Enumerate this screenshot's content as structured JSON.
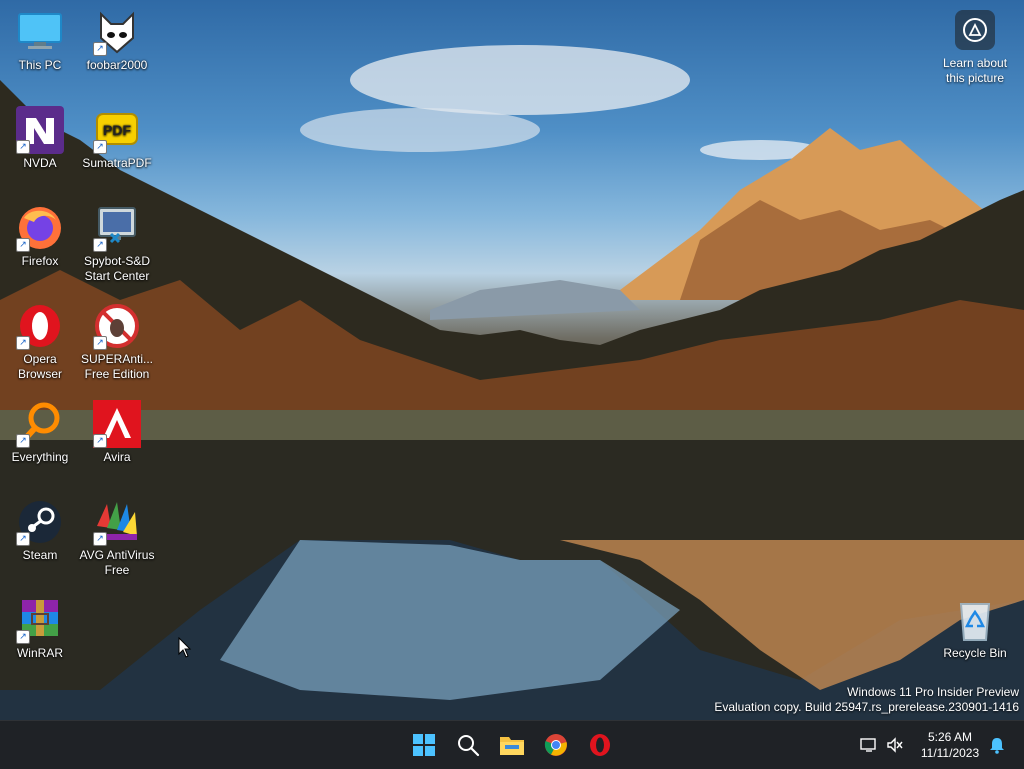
{
  "desktop": {
    "icons": [
      {
        "id": "this-pc",
        "label": "This PC"
      },
      {
        "id": "foobar2000",
        "label": "foobar2000"
      },
      {
        "id": "nvda",
        "label": "NVDA"
      },
      {
        "id": "sumatrapdf",
        "label": "SumatraPDF"
      },
      {
        "id": "firefox",
        "label": "Firefox"
      },
      {
        "id": "spybot",
        "label": "Spybot-S&D Start Center"
      },
      {
        "id": "opera",
        "label": "Opera Browser"
      },
      {
        "id": "superantispyware",
        "label": "SUPERAnti... Free Edition"
      },
      {
        "id": "everything",
        "label": "Everything"
      },
      {
        "id": "avira",
        "label": "Avira"
      },
      {
        "id": "steam",
        "label": "Steam"
      },
      {
        "id": "avg",
        "label": "AVG AntiVirus Free"
      },
      {
        "id": "winrar",
        "label": "WinRAR"
      },
      {
        "id": "recycle-bin",
        "label": "Recycle Bin"
      }
    ],
    "learn_about": "Learn about this picture",
    "watermark": {
      "line1": "Windows 11 Pro Insider Preview",
      "line2": "Evaluation copy. Build 25947.rs_prerelease.230901-1416"
    }
  },
  "taskbar": {
    "buttons": [
      "start-icon",
      "search-icon",
      "file-explorer-icon",
      "chrome-icon",
      "opera-icon"
    ],
    "clock": {
      "time": "5:26 AM",
      "date": "11/11/2023"
    }
  }
}
